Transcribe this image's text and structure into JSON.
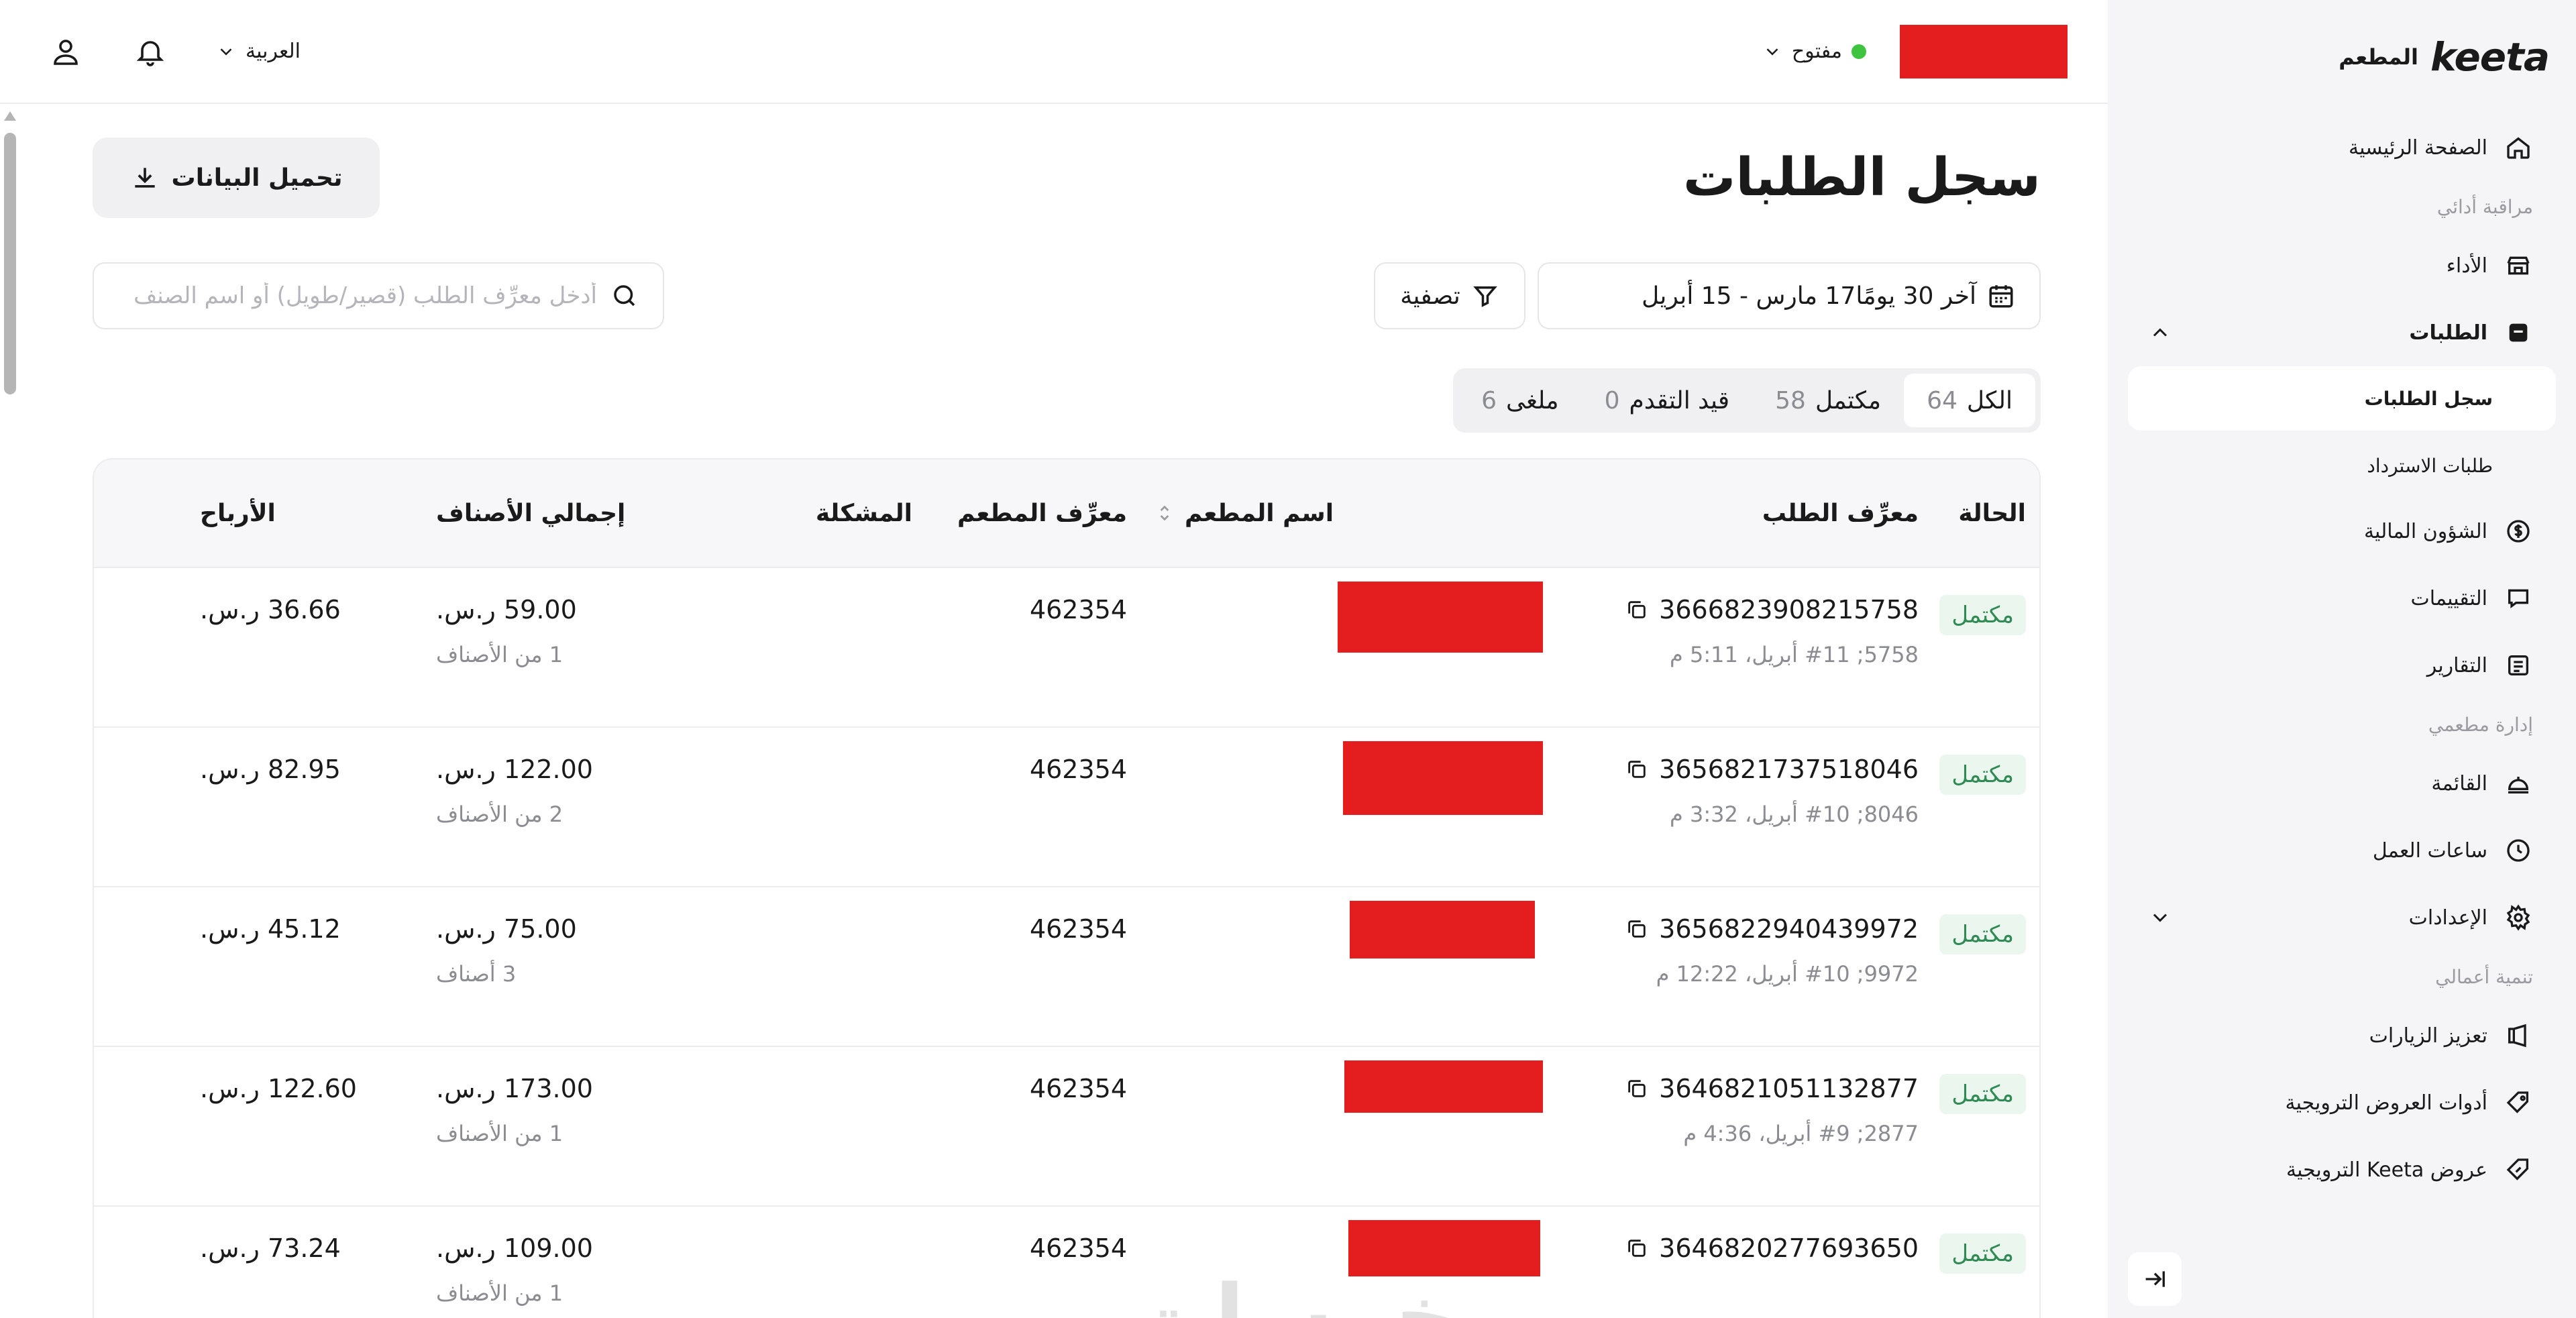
{
  "brand": {
    "logo": "keeta",
    "label": "المطعم"
  },
  "sidebar": {
    "home": "الصفحة الرئيسية",
    "section_monitor": "مراقبة أدائي",
    "performance": "الأداء",
    "orders": "الطلبات",
    "order_history": "سجل الطلبات",
    "refund_requests": "طلبات الاسترداد",
    "finance": "الشؤون المالية",
    "ratings": "التقييمات",
    "reports": "التقارير",
    "section_manage": "إدارة مطعمي",
    "menu": "القائمة",
    "hours": "ساعات العمل",
    "settings": "الإعدادات",
    "section_grow": "تنمية أعمالي",
    "boost_visits": "تعزيز الزيارات",
    "promo_tools": "أدوات العروض الترويجية",
    "keeta_promos": "عروض Keeta الترويجية"
  },
  "topbar": {
    "status": "مفتوح",
    "language": "العربية"
  },
  "page": {
    "title": "سجل الطلبات",
    "download_label": "تحميل البيانات",
    "date_range": "آخر 30 يومًا17 مارس - 15 أبريل",
    "filter_label": "تصفية",
    "search_placeholder": "أدخل معرِّف الطلب (قصير/طويل) أو اسم الصنف"
  },
  "tabs": [
    {
      "label": "الكل",
      "count": "64"
    },
    {
      "label": "مكتمل",
      "count": "58"
    },
    {
      "label": "قيد التقدم",
      "count": "0"
    },
    {
      "label": "ملغى",
      "count": "6"
    }
  ],
  "table": {
    "headers": {
      "status": "الحالة",
      "order_id": "معرِّف الطلب",
      "restaurant_name": "اسم المطعم",
      "restaurant_id": "معرِّف المطعم",
      "issue": "المشكلة",
      "items_total": "إجمالي الأصناف",
      "profit": "الأرباح"
    },
    "rows": [
      {
        "status": "مكتمل",
        "order_id": "3666823908215758",
        "meta": "5758; #11 أبريل، 5:11 م",
        "restaurant_id": "462354",
        "items_total": "59.00 ر.س.",
        "items_count": "1 من الأصناف",
        "profit": "36.66 ر.س."
      },
      {
        "status": "مكتمل",
        "order_id": "3656821737518046",
        "meta": "8046; #10 أبريل، 3:32 م",
        "restaurant_id": "462354",
        "items_total": "122.00 ر.س.",
        "items_count": "2 من الأصناف",
        "profit": "82.95 ر.س."
      },
      {
        "status": "مكتمل",
        "order_id": "3656822940439972",
        "meta": "9972; #10 أبريل، 12:22 م",
        "restaurant_id": "462354",
        "items_total": "75.00 ر.س.",
        "items_count": "3 أصناف",
        "profit": "45.12 ر.س."
      },
      {
        "status": "مكتمل",
        "order_id": "3646821051132877",
        "meta": "2877; #9 أبريل، 4:36 م",
        "restaurant_id": "462354",
        "items_total": "173.00 ر.س.",
        "items_count": "1 من الأصناف",
        "profit": "122.60 ر.س."
      },
      {
        "status": "مكتمل",
        "order_id": "3646820277693650",
        "meta": "",
        "restaurant_id": "462354",
        "items_total": "109.00 ر.س.",
        "items_count": "1 من الأصناف",
        "profit": "73.24 ر.س."
      }
    ]
  },
  "watermark": "خمسات",
  "colors": {
    "accent_green": "#2f8b53",
    "redaction": "#e41e1e",
    "status_dot": "#3ec43e"
  }
}
